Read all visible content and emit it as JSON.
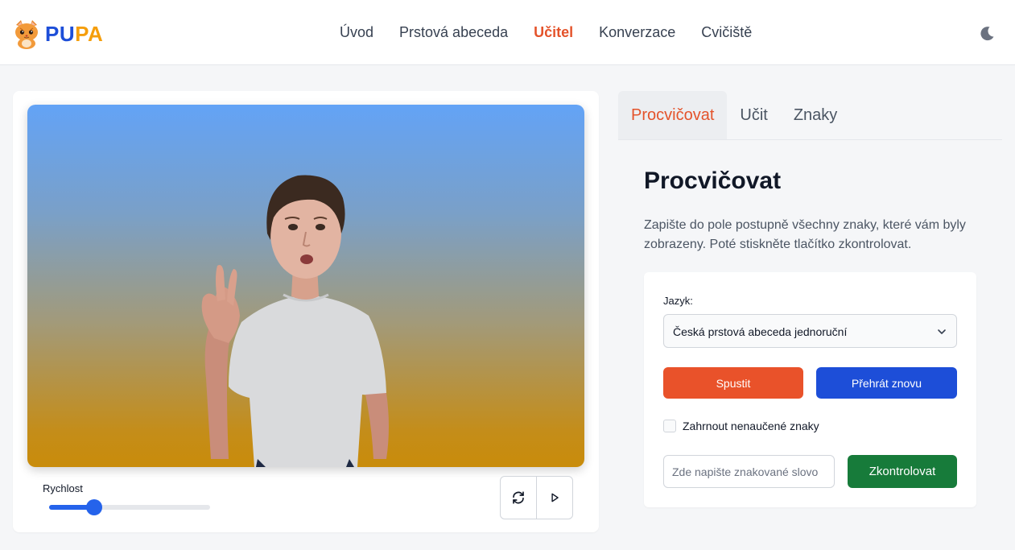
{
  "app": {
    "logo_text_part1": "PU",
    "logo_text_part2": "PA"
  },
  "nav": {
    "items": [
      "Úvod",
      "Prstová abeceda",
      "Učitel",
      "Konverzace",
      "Cvičiště"
    ],
    "active": "Učitel"
  },
  "player": {
    "speed_label": "Rychlost",
    "speed_value": 0.28
  },
  "tabs": {
    "items": [
      "Procvičovat",
      "Učit",
      "Znaky"
    ],
    "active": "Procvičovat"
  },
  "panel": {
    "title": "Procvičovat",
    "description": "Zapište do pole postupně všechny znaky, které vám byly zobrazeny. Poté stiskněte tlačítko zkontrolovat.",
    "language_label": "Jazyk:",
    "language_value": "Česká prstová abeceda jednoruční",
    "start_button": "Spustit",
    "replay_button": "Přehrát znovu",
    "include_checkbox_label": "Zahrnout nenaučené znaky",
    "include_checked": false,
    "word_placeholder": "Zde napište znakované slovo",
    "check_button": "Zkontrolovat"
  },
  "colors": {
    "accent": "#e4532b",
    "primary": "#1d4ed8",
    "success": "#177b3a"
  }
}
